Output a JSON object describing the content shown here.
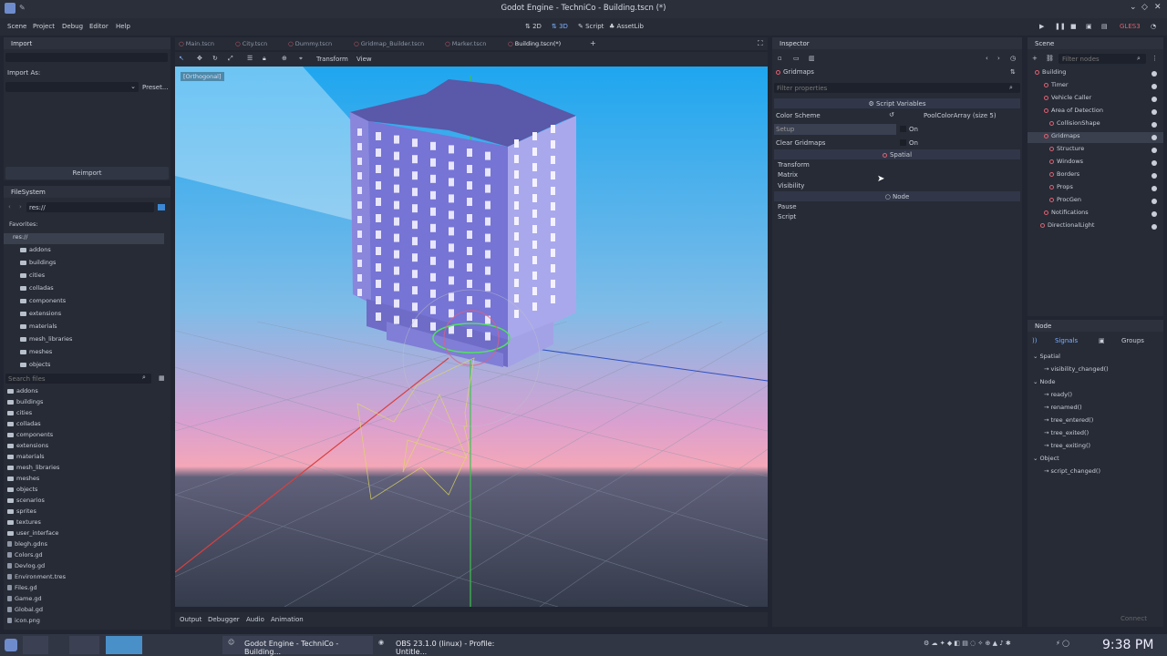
{
  "window": {
    "title": "Godot Engine - TechniCo - Building.tscn (*)"
  },
  "menu": [
    "Scene",
    "Project",
    "Debug",
    "Editor",
    "Help"
  ],
  "modes": [
    "2D",
    "3D",
    "Script",
    "AssetLib"
  ],
  "renderer": "GLES3",
  "import_panel": {
    "title": "Import",
    "import_as": "Import As:",
    "preset": "Preset...",
    "reimport": "Reimport"
  },
  "filesystem": {
    "title": "FileSystem",
    "path": "res://",
    "favorites": "Favorites:",
    "root": "res://",
    "tree": [
      "addons",
      "buildings",
      "cities",
      "colladas",
      "components",
      "extensions",
      "materials",
      "mesh_libraries",
      "meshes",
      "objects"
    ],
    "search_placeholder": "Search files",
    "files": [
      "addons",
      "buildings",
      "cities",
      "colladas",
      "components",
      "extensions",
      "materials",
      "mesh_libraries",
      "meshes",
      "objects",
      "scenarios",
      "sprites",
      "textures",
      "user_interface",
      "blegh.gdns",
      "Colors.gd",
      "Devlog.gd",
      "Environment.tres",
      "Files.gd",
      "Game.gd",
      "Global.gd",
      "icon.png"
    ]
  },
  "scene_tabs": [
    "Main.tscn",
    "City.tscn",
    "Dummy.tscn",
    "Gridmap_Builder.tscn",
    "Marker.tscn",
    "Building.tscn(*)"
  ],
  "viewport": {
    "toolbar": [
      "Transform",
      "View"
    ],
    "projection": "Orthogonal"
  },
  "bottom_tabs": [
    "Output",
    "Debugger",
    "Audio",
    "Animation"
  ],
  "inspector": {
    "title": "Inspector",
    "node_name": "Gridmaps",
    "filter_placeholder": "Filter properties",
    "section_script": "Script Variables",
    "color_scheme_label": "Color Scheme",
    "color_scheme_value": "PoolColorArray (size 5)",
    "setup_label": "Setup",
    "setup_value": "On",
    "clear_label": "Clear Gridmaps",
    "clear_value": "On",
    "section_spatial": "Spatial",
    "spatial_groups": [
      "Transform",
      "Matrix",
      "Visibility"
    ],
    "section_node": "Node",
    "node_groups": [
      "Pause",
      "Script"
    ]
  },
  "scene_dock": {
    "title": "Scene",
    "filter_placeholder": "Filter nodes",
    "nodes": [
      "Building",
      "Timer",
      "Vehicle Caller",
      "Area of Detection",
      "CollisionShape",
      "Gridmaps",
      "Structure",
      "Windows",
      "Borders",
      "Props",
      "ProcGen",
      "Notifications",
      "DirectionalLight"
    ]
  },
  "node_dock": {
    "title": "Node",
    "tabs": [
      "Signals",
      "Groups"
    ],
    "spatial_section": "Spatial",
    "spatial_signals": [
      "visibility_changed()"
    ],
    "node_section": "Node",
    "node_signals": [
      "ready()",
      "renamed()",
      "tree_entered()",
      "tree_exited()",
      "tree_exiting()"
    ],
    "object_section": "Object",
    "object_signals": [
      "script_changed()"
    ],
    "connect": "Connect"
  },
  "taskbar": {
    "items": [
      "Godot Engine - TechniCo - Building...",
      "OBS 23.1.0 (linux) - Profile: Untitle..."
    ],
    "clock": "9:38 PM"
  },
  "colors": {
    "accent": "#3b88d4",
    "sky_top": "#3aa8e8",
    "sky_horizon": "#f0a0c0",
    "ground": "#2e3544",
    "building": "#7470d0"
  }
}
